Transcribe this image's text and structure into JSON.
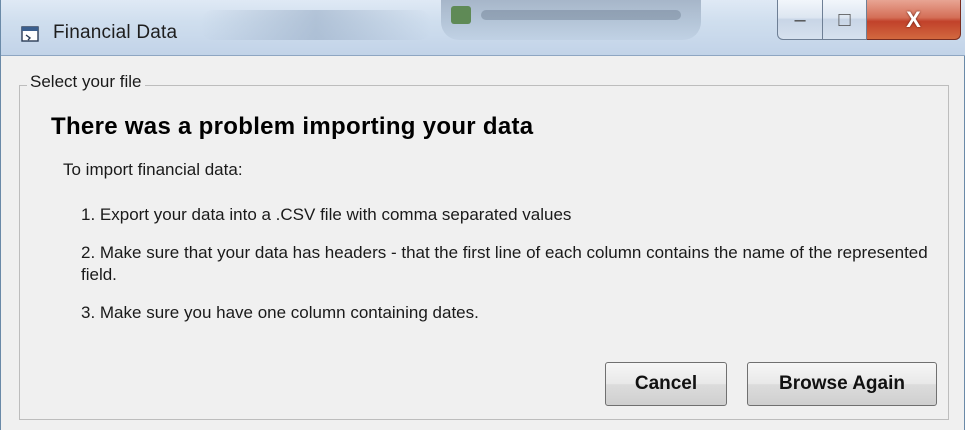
{
  "window": {
    "title": "Financial Data",
    "app_icon": "application-window-icon",
    "controls": {
      "minimize": "–",
      "maximize": "□",
      "close": "X"
    }
  },
  "groupbox": {
    "label": "Select your file"
  },
  "message": {
    "heading": "There was a problem importing your data",
    "intro": "To import financial data:",
    "steps": [
      "1. Export your data into a .CSV file with comma separated values",
      "2. Make sure that your data has headers - that the first line of each column contains the name of the represented field.",
      "3. Make sure you have one column containing dates."
    ]
  },
  "buttons": {
    "cancel": "Cancel",
    "browse_again": "Browse Again"
  }
}
